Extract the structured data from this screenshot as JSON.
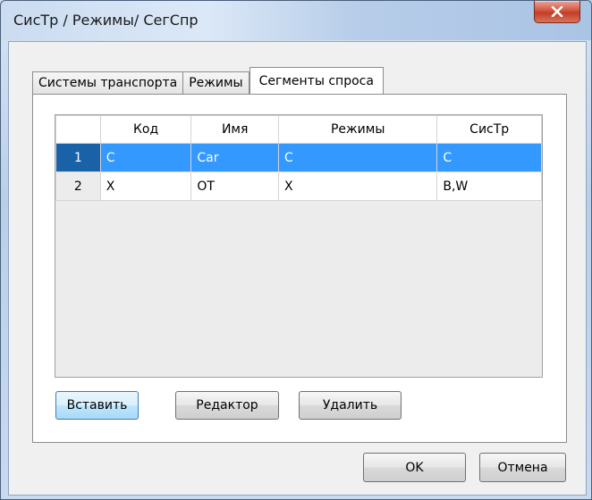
{
  "window": {
    "title": "СисТр / Режимы/ СегСпр",
    "close_label": "X"
  },
  "tabs": [
    {
      "label": "Системы транспорта",
      "active": false
    },
    {
      "label": "Режимы",
      "active": false
    },
    {
      "label": "Сегменты спроса",
      "active": true
    }
  ],
  "grid": {
    "columns": [
      "Код",
      "Имя",
      "Режимы",
      "СисТр"
    ],
    "rows": [
      {
        "num": "1",
        "cells": [
          "C",
          "Car",
          "C",
          "C"
        ],
        "selected": true
      },
      {
        "num": "2",
        "cells": [
          "X",
          "OT",
          "X",
          "B,W"
        ],
        "selected": false
      }
    ]
  },
  "buttons": {
    "insert": "Вставить",
    "edit": "Редактор",
    "delete": "Удалить",
    "ok": "OK",
    "cancel": "Отмена"
  },
  "colors": {
    "selection": "#3399ff",
    "selection_header": "#1a62a8",
    "close_button": "#c23c25"
  }
}
